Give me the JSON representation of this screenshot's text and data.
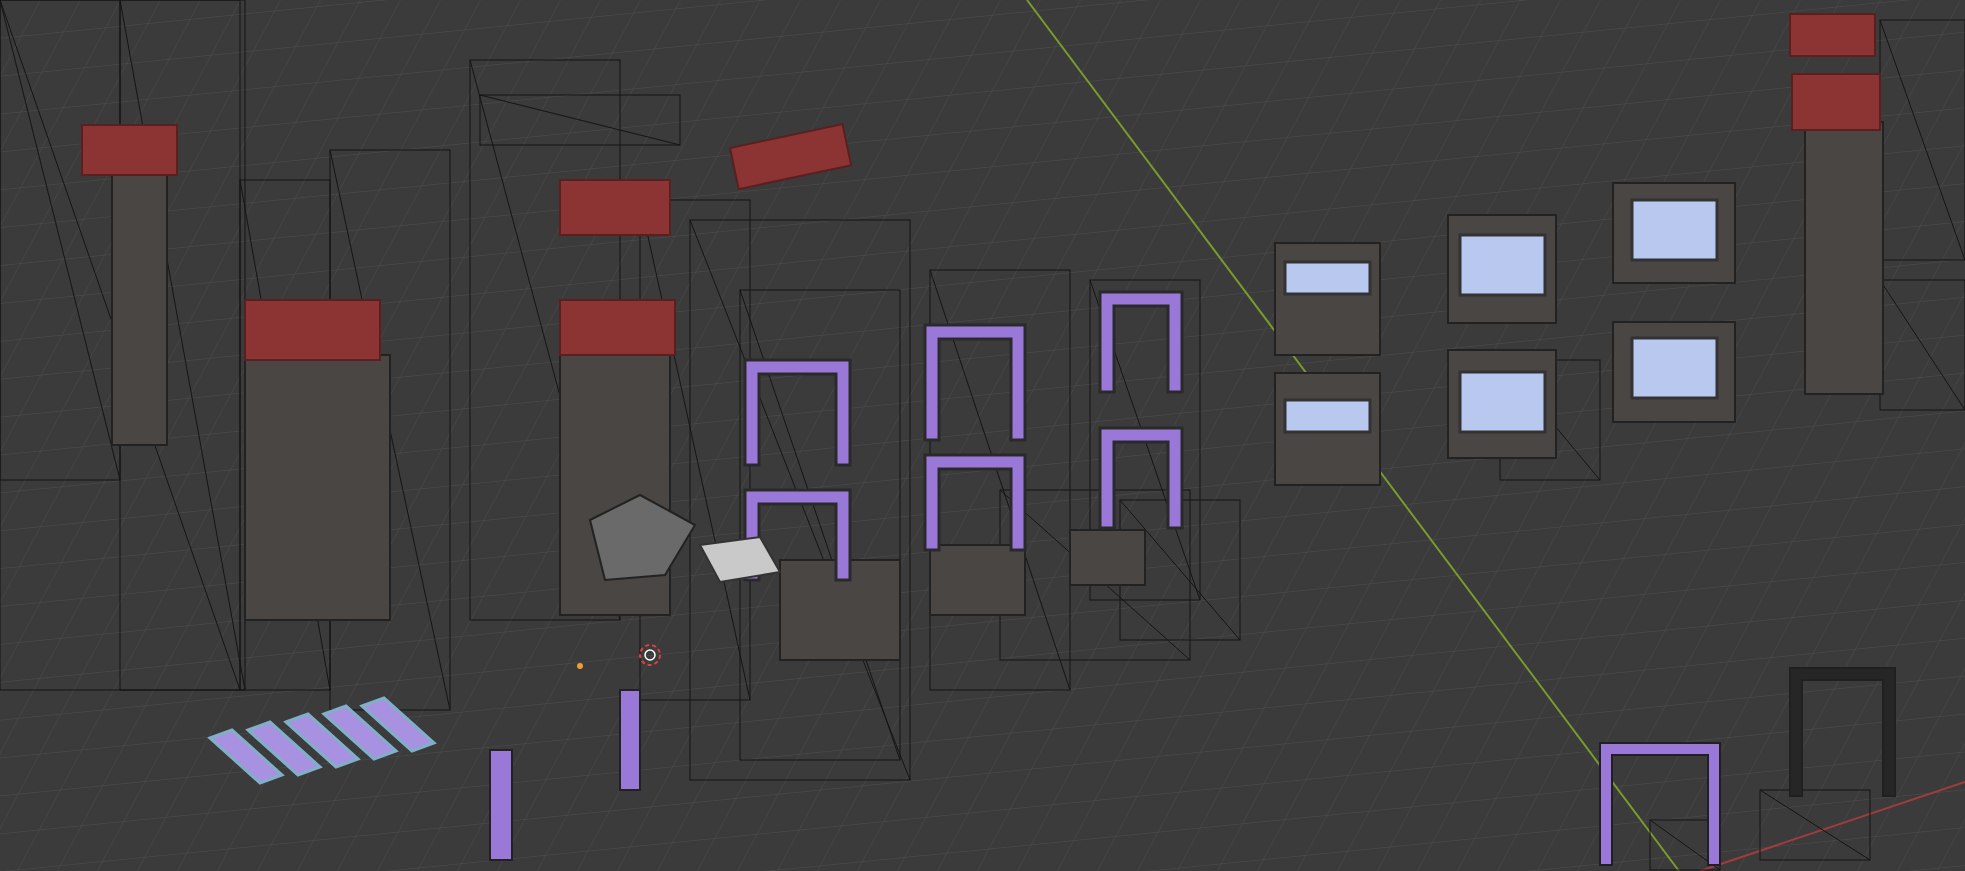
{
  "viewport": {
    "kind": "scene"
  }
}
